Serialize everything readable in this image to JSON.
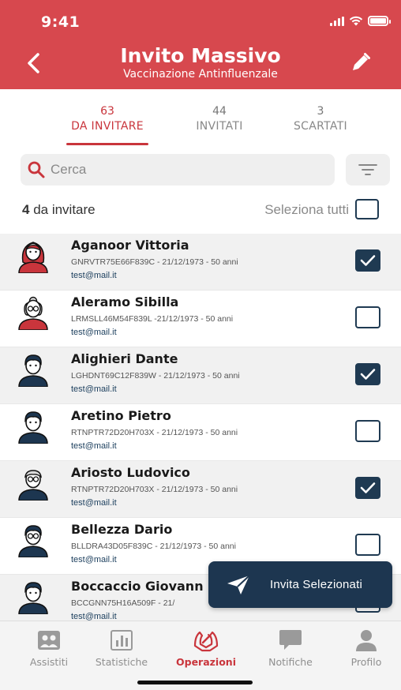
{
  "status": {
    "time": "9:41"
  },
  "header": {
    "title": "Invito Massivo",
    "subtitle": "Vaccinazione Antinfluenzale",
    "back_icon": "chevron-left-icon",
    "edit_icon": "pencil-icon"
  },
  "tabs": [
    {
      "count": "63",
      "label": "DA INVITARE",
      "active": true
    },
    {
      "count": "44",
      "label": "INVITATI",
      "active": false
    },
    {
      "count": "3",
      "label": "SCARTATI",
      "active": false
    }
  ],
  "search": {
    "placeholder": "Cerca",
    "icon": "search-icon"
  },
  "filter": {
    "icon": "filter-icon"
  },
  "list_header": {
    "count": "4",
    "count_label": " da invitare",
    "select_all": "Seleziona tutti"
  },
  "patients": [
    {
      "name": "Aganoor Vittoria",
      "details": "GNRVTR75E66F839C - 21/12/1973 - 50 anni",
      "email": "test@mail.it",
      "checked": true,
      "avatar": "woman-red-hair"
    },
    {
      "name": "Aleramo Sibilla",
      "details": "LRMSLL46M54F839L -21/12/1973 - 50 anni",
      "email": "test@mail.it",
      "checked": false,
      "avatar": "elderly-woman"
    },
    {
      "name": "Alighieri Dante",
      "details": "LGHDNT69C12F839W - 21/12/1973 - 50 anni",
      "email": "test@mail.it",
      "checked": true,
      "avatar": "man"
    },
    {
      "name": "Aretino Pietro",
      "details": "RTNPTR72D20H703X - 21/12/1973 - 50 anni",
      "email": "test@mail.it",
      "checked": false,
      "avatar": "man"
    },
    {
      "name": "Ariosto Ludovico",
      "details": "RTNPTR72D20H703X - 21/12/1973 - 50 anni",
      "email": "test@mail.it",
      "checked": true,
      "avatar": "elderly-man-glasses"
    },
    {
      "name": "Bellezza Dario",
      "details": "BLLDRA43D05F839C - 21/12/1973 - 50 anni",
      "email": "test@mail.it",
      "checked": false,
      "avatar": "man-glasses"
    },
    {
      "name": "Boccaccio Giovann",
      "details": "BCCGNN75H16A509F - 21/",
      "email": "test@mail.it",
      "checked": false,
      "avatar": "man"
    }
  ],
  "fab": {
    "label": "Invita Selezionati",
    "icon": "send-icon"
  },
  "nav": [
    {
      "label": "Assistiti",
      "icon": "people-icon",
      "active": false
    },
    {
      "label": "Statistiche",
      "icon": "chart-icon",
      "active": false
    },
    {
      "label": "Operazioni",
      "icon": "syringe-hands-icon",
      "active": true
    },
    {
      "label": "Notifiche",
      "icon": "chat-icon",
      "active": false
    },
    {
      "label": "Profilo",
      "icon": "user-icon",
      "active": false
    }
  ],
  "colors": {
    "brand_red": "#d7484e",
    "active_red": "#c9353c",
    "navy": "#1d3650"
  }
}
